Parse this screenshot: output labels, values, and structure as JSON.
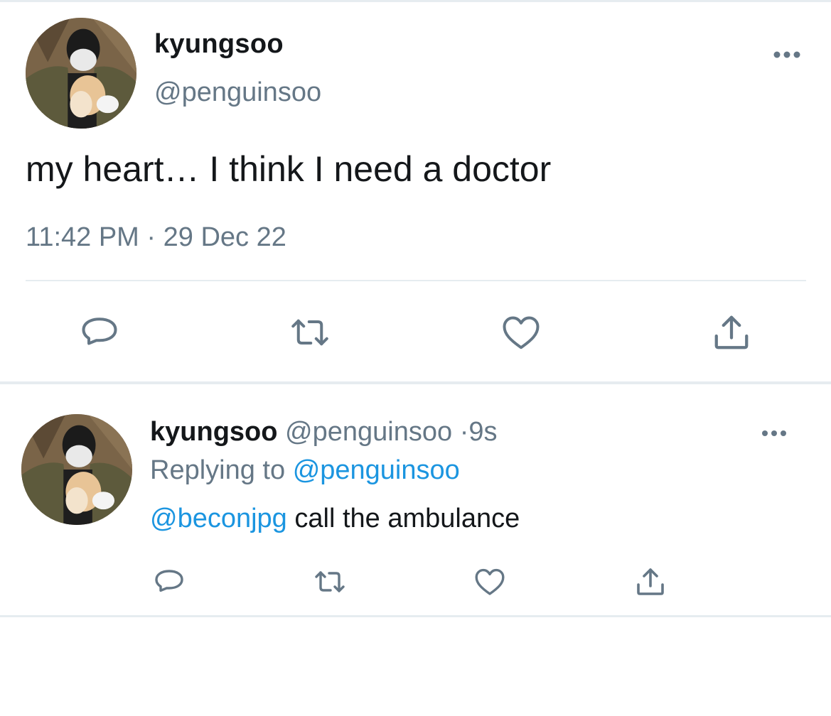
{
  "main_tweet": {
    "display_name": "kyungsoo",
    "handle": "@penguinsoo",
    "text": "my heart… I think I need a doctor",
    "time": "11:42 PM",
    "separator": "·",
    "date": "29 Dec 22",
    "more_icon": "ellipsis-icon",
    "actions": [
      "reply-icon",
      "retweet-icon",
      "like-icon",
      "share-icon"
    ]
  },
  "reply_tweet": {
    "display_name": "kyungsoo",
    "handle": "@penguinsoo",
    "separator": "·",
    "age": "9s",
    "replying_prefix": "Replying to",
    "replying_handle": "@penguinsoo",
    "mention": "@beconjpg",
    "text": " call the ambulance",
    "more_icon": "ellipsis-icon",
    "actions": [
      "reply-icon",
      "retweet-icon",
      "like-icon",
      "share-icon"
    ]
  },
  "colors": {
    "text_primary": "#14171a",
    "text_secondary": "#657786",
    "link": "#1b95e0",
    "icon": "#657786",
    "divider": "#e6ecf0"
  }
}
